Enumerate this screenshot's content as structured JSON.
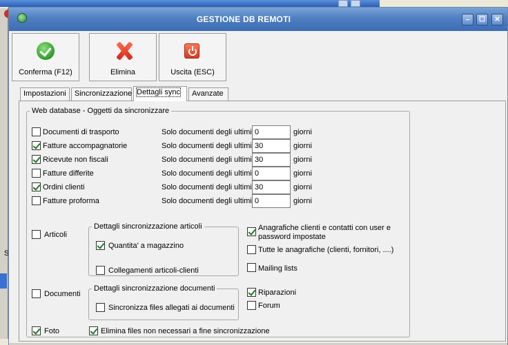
{
  "dialog": {
    "title": "GESTIONE DB REMOTI",
    "controls": {
      "minimize": "–",
      "maximize": "☐",
      "close": "✕"
    }
  },
  "background": {
    "side_text": "Se"
  },
  "toolbar": {
    "confirm_label": "Conferma (F12)",
    "delete_label": "Elimina",
    "exit_label": "Uscita (ESC)"
  },
  "tabs": [
    {
      "label": "Impostazioni"
    },
    {
      "label": "Sincronizzazione"
    },
    {
      "label": "Dettagli sync"
    },
    {
      "label": "Avanzate"
    }
  ],
  "active_tab": "Dettagli sync",
  "web_group": {
    "legend": "Web database - Oggetti da sincronizzare",
    "prefix_label": "Solo documenti degli ultimi",
    "suffix_label": "giorni",
    "documents": [
      {
        "label": "Documenti di trasporto",
        "checked": false,
        "days": "0"
      },
      {
        "label": "Fatture accompagnatorie",
        "checked": true,
        "days": "30"
      },
      {
        "label": "Ricevute non fiscali",
        "checked": true,
        "days": "30"
      },
      {
        "label": "Fatture differite",
        "checked": false,
        "days": "0"
      },
      {
        "label": "Ordini clienti",
        "checked": true,
        "days": "30"
      },
      {
        "label": "Fatture proforma",
        "checked": false,
        "days": "0"
      }
    ],
    "articoli": {
      "label": "Articoli",
      "checked": false
    },
    "articoli_group": {
      "legend": "Dettagli sincronizzazione articoli",
      "quantita": {
        "label": "Quantita' a magazzino",
        "checked": true
      },
      "collegamenti": {
        "label": "Collegamenti articoli-clienti",
        "checked": false
      }
    },
    "anagrafiche_user": {
      "label_line1": "Anagrafiche clienti e contatti con user e",
      "label_line2": "password impostate",
      "checked": true
    },
    "tutte_anagrafiche": {
      "label": "Tutte le anagrafiche (clienti, fornitori, ....)",
      "checked": false
    },
    "mailing": {
      "label": "Mailing lists",
      "checked": false
    },
    "documenti": {
      "label": "Documenti",
      "checked": false
    },
    "documenti_group": {
      "legend": "Dettagli sincronizzazione documenti",
      "allegati": {
        "label": "Sincronizza files allegati ai documenti",
        "checked": false
      }
    },
    "riparazioni": {
      "label": "Riparazioni",
      "checked": true
    },
    "forum": {
      "label": "Forum",
      "checked": false
    },
    "foto": {
      "label": "Foto",
      "checked": true
    },
    "elimina_files": {
      "label": "Elimina files non necessari a fine sincronizzazione",
      "checked": true
    }
  }
}
